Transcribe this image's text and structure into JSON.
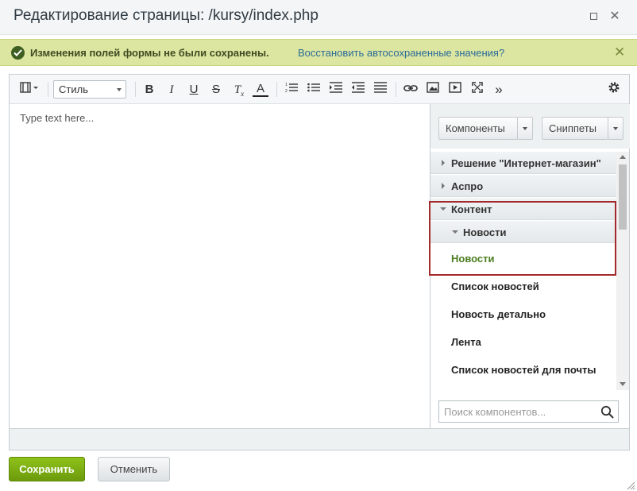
{
  "dialog": {
    "title": "Редактирование страницы: /kursy/index.php"
  },
  "warning": {
    "message": "Изменения полей формы не были сохранены.",
    "restore_link": "Восстановить автосохраненные значения?"
  },
  "toolbar": {
    "style_select_value": "Стиль",
    "icons": [
      "view-mode-icon",
      "bold-icon",
      "italic-icon",
      "underline-icon",
      "strikethrough-icon",
      "remove-format-icon",
      "text-color-icon",
      "ordered-list-icon",
      "unordered-list-icon",
      "indent-icon",
      "outdent-icon",
      "align-icon",
      "link-icon",
      "image-icon",
      "video-icon",
      "fullscreen-icon",
      "more-icon",
      "settings-icon"
    ],
    "bold_label": "B",
    "italic_label": "I",
    "underline_label": "U",
    "strike_label": "S",
    "clear_label": "T",
    "clear_sub": "x",
    "color_label": "A",
    "more_label": "»"
  },
  "editor": {
    "placeholder": "Type text here..."
  },
  "side_panel": {
    "components_button": "Компоненты",
    "snippets_button": "Сниппеты",
    "tree": [
      {
        "label": "Решение \"Интернет-магазин\"",
        "expanded": false
      },
      {
        "label": "Аспро",
        "expanded": false
      },
      {
        "label": "Контент",
        "expanded": true
      },
      {
        "label": "Новости",
        "expanded": true
      }
    ],
    "items": [
      "Новости",
      "Список новостей",
      "Новость детально",
      "Лента",
      "Список новостей для почты"
    ],
    "search_placeholder": "Поиск компонентов..."
  },
  "footer": {
    "save_button": "Сохранить",
    "cancel_button": "Отменить"
  },
  "colors": {
    "accent_green": "#6c9a0c",
    "active_item": "#4a7d1e",
    "warning_bg": "#dce6a0",
    "highlight_border": "#a32a2a",
    "link": "#2b6a98"
  }
}
